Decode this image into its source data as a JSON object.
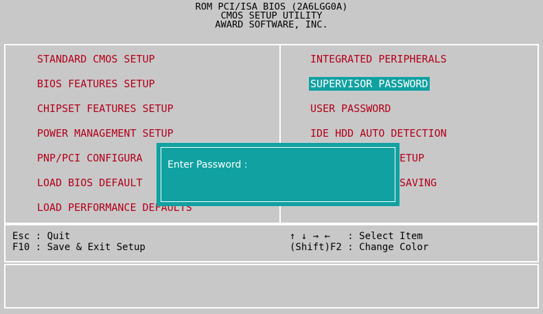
{
  "header": {
    "line1": "ROM PCI/ISA BIOS (2A6LGG0A)",
    "line2": "CMOS SETUP UTILITY",
    "line3": "AWARD SOFTWARE, INC."
  },
  "menu": {
    "left": [
      "STANDARD CMOS SETUP",
      "BIOS FEATURES SETUP",
      "CHIPSET FEATURES SETUP",
      "POWER MANAGEMENT SETUP",
      "PNP/PCI CONFIGURA",
      "LOAD BIOS DEFAULT",
      "LOAD PERFORMANCE DEFAULTS"
    ],
    "right": [
      "INTEGRATED PERIPHERALS",
      "SUPERVISOR PASSWORD",
      "USER PASSWORD",
      "IDE HDD AUTO DETECTION",
      "ETUP",
      "SAVING"
    ],
    "selected": "SUPERVISOR PASSWORD"
  },
  "help": {
    "left_line1": "Esc : Quit",
    "left_line2": "F10 : Save & Exit Setup",
    "right_line1": "↑ ↓ → ←   : Select Item",
    "right_line2": "(Shift)F2 : Change Color"
  },
  "dialog": {
    "prompt": "Enter Password :"
  },
  "colors": {
    "background": "#c8c8c8",
    "menu_text": "#b3001b",
    "highlight": "#11a1a1",
    "frame": "#ffffff"
  }
}
